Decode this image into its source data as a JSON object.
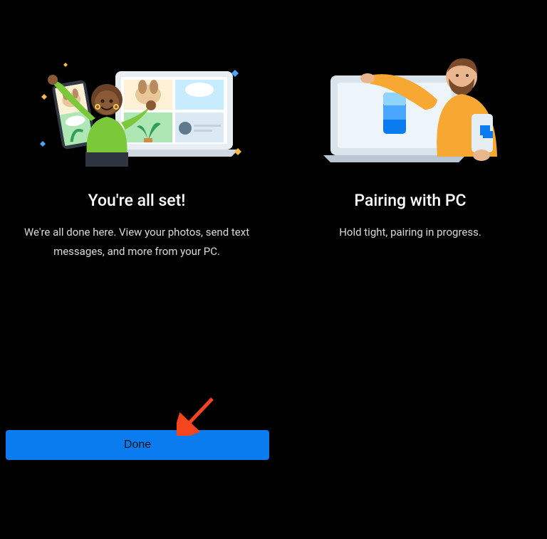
{
  "left": {
    "title": "You're all set!",
    "subtitle": "We're all done here. View your photos, send text messages, and more from your PC."
  },
  "right": {
    "title": "Pairing with PC",
    "subtitle": "Hold tight, pairing in progress."
  },
  "button": {
    "done": "Done"
  },
  "colors": {
    "accent": "#0a7cf0",
    "arrow": "#f4451f"
  }
}
